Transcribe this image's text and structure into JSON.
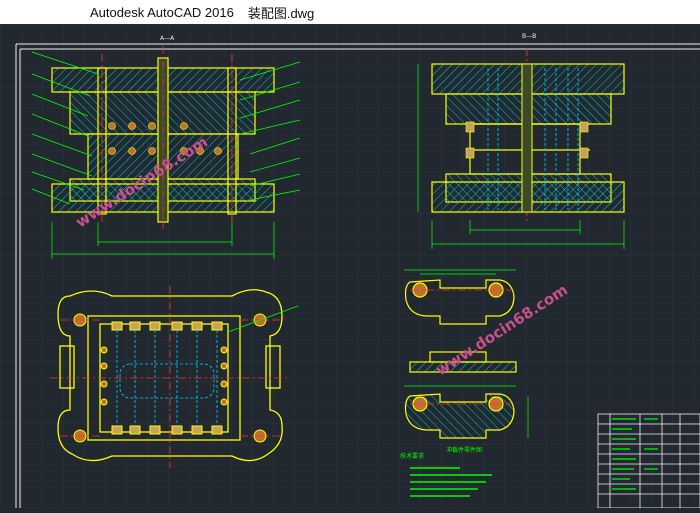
{
  "window": {
    "app_title": "Autodesk AutoCAD 2016",
    "file_name": "装配图.dwg"
  },
  "drawing": {
    "section_a_label": "A—A",
    "section_b_label": "B—B",
    "watermark": "www.docin68.com",
    "part_title": "冲裁件零件图",
    "tech_req_heading": "技术要求",
    "accent_colors": {
      "background": "#212830",
      "grid": "#2c3540",
      "outline": "#ffff00",
      "hatch": "#00c8c8",
      "leader": "#00ff00",
      "center": "#ff3030",
      "hidden": "#00d0ff",
      "watermark": "#c8508c"
    }
  }
}
